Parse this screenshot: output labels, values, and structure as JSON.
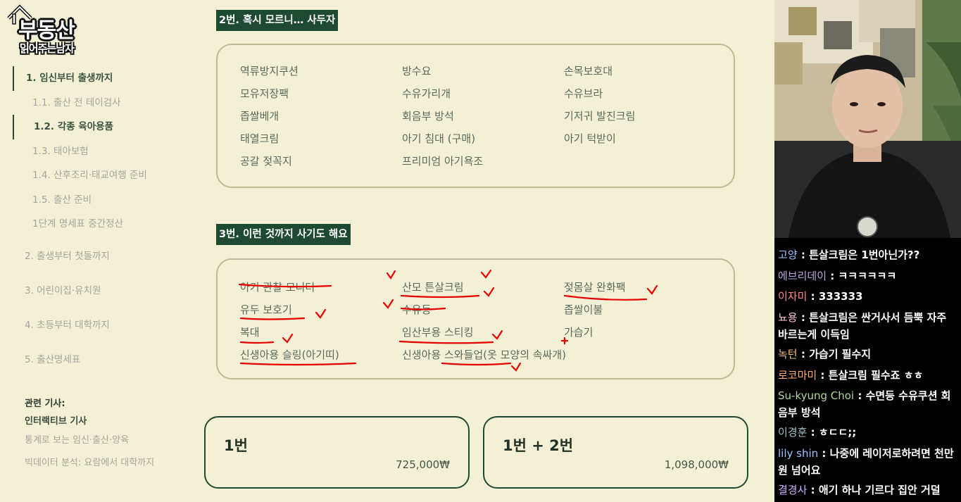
{
  "logo": {
    "title": "부동산",
    "subtitle": "읽어주는남자"
  },
  "sidebar": {
    "items": [
      {
        "label": "1. 임신부터 출생까지"
      },
      {
        "label": "1.1. 출산 전 테이검사"
      },
      {
        "label": "1.2. 각종 육아용품"
      },
      {
        "label": "1.3. 태아보험"
      },
      {
        "label": "1.4. 산후조리·태교여행 준비"
      },
      {
        "label": "1.5. 출산 준비"
      },
      {
        "label": "1단계 명세표 중간정산"
      },
      {
        "label": "2. 출생부터 첫돌까지"
      },
      {
        "label": "3. 어린이집·유치원"
      },
      {
        "label": "4. 초등부터 대학까지"
      },
      {
        "label": "5. 출산명세표"
      }
    ],
    "related": {
      "heading": "관련 기사:",
      "subheading": "인터랙티브 기사",
      "articles": [
        "통계로 보는 임신·출산·양육",
        "빅데이터 분석: 요람에서 대학까지"
      ]
    }
  },
  "section2": {
    "title": "2번. 혹시 모르니… 사두자",
    "columns": [
      [
        "역류방지쿠션",
        "모유저장팩",
        "좁쌀베개",
        "태열크림",
        "공갈 젖꼭지"
      ],
      [
        "방수요",
        "수유가리개",
        "회음부 방석",
        "아기 침대 (구매)",
        "프리미엄 아기욕조"
      ],
      [
        "손목보호대",
        "수유브라",
        "기저귀 발진크림",
        "아기 턱받이"
      ]
    ]
  },
  "section3": {
    "title": "3번. 이런 것까지 사기도 해요",
    "columns": [
      [
        "아기 관찰 모니터",
        "유두 보호기",
        "복대",
        "신생아용 슬링(아기띠)"
      ],
      [
        "산모 튼살크림",
        "수유등",
        "임산부용 스티킹",
        "신생아용 스와들업(옷 모양의 속싸개)"
      ],
      [
        "젖몸살 완화팩",
        "좁쌀이불",
        "가습기"
      ]
    ]
  },
  "totals": [
    {
      "label": "1번",
      "price": "725,000₩"
    },
    {
      "label": "1번 + 2번",
      "price": "1,098,000₩"
    }
  ],
  "chat": {
    "messages": [
      {
        "name": "고양",
        "text": "튼살크림은 1번아닌가??",
        "color": "#9cc4ff"
      },
      {
        "name": "에브리데이",
        "text": "ㅋㅋㅋㅋㅋㅋ",
        "color": "#b8a4e0"
      },
      {
        "name": "이자미",
        "text": "333333",
        "color": "#ff8a8a"
      },
      {
        "name": "뇨용",
        "text": "튼살크림은 싼거사서 듬뿍 자주 바르는게 이득임",
        "color": "#ffc4d8"
      },
      {
        "name": "녹턴",
        "text": "가습기 필수지",
        "color": "#f0c080"
      },
      {
        "name": "로코마미",
        "text": "튼살크림 필수죠 ㅎㅎ",
        "color": "#ffb070"
      },
      {
        "name": "Su-kyung Choi",
        "text": "수면등 수유쿠션 회음부 방석",
        "color": "#b0d8a0"
      },
      {
        "name": "이경훈",
        "text": "ㅎㄷㄷ;;",
        "color": "#a0c0c8"
      },
      {
        "name": "lily shin",
        "text": "나중에 레이저로하려면 천만원 넘어요",
        "color": "#9cc4ff"
      },
      {
        "name": "결경사",
        "text": "애기 하나 기르다 집안 거덜",
        "color": "#c8b0ff"
      }
    ]
  },
  "colors": {
    "background": "#f4f0d6",
    "accent": "#1e4a32",
    "annotation": "#e60000"
  }
}
